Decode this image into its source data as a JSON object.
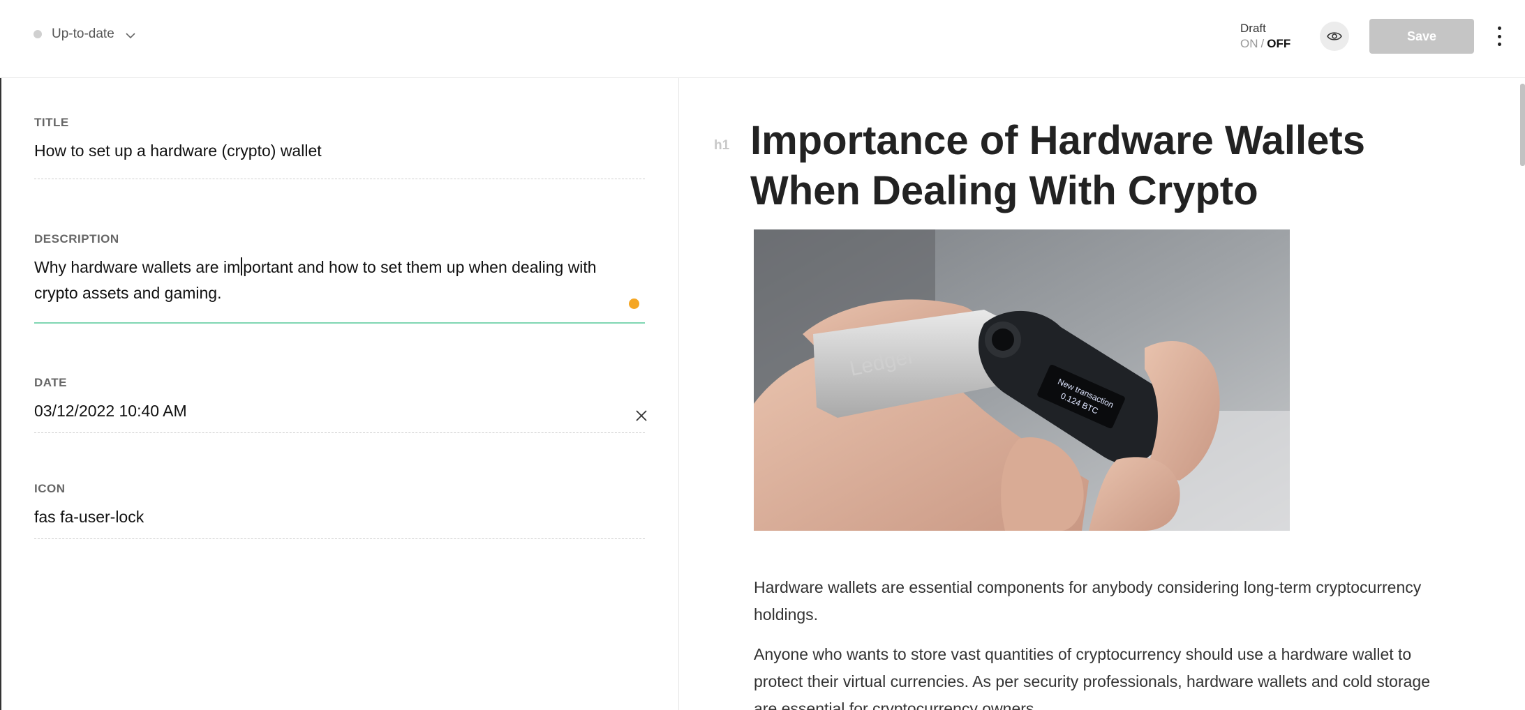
{
  "header": {
    "status_label": "Up-to-date",
    "draft_label": "Draft",
    "draft_on": "ON",
    "draft_sep": "/",
    "draft_off": "OFF",
    "save_label": "Save"
  },
  "form": {
    "title": {
      "label": "TITLE",
      "value": "How to set up a hardware (crypto) wallet"
    },
    "description": {
      "label": "DESCRIPTION",
      "value_before_caret": "Why hardware wallets are im",
      "value_after_caret": "portant and how to set them up when dealing with",
      "value_line2": "crypto assets and gaming."
    },
    "date": {
      "label": "DATE",
      "value": "03/12/2022 10:40 AM"
    },
    "icon": {
      "label": "ICON",
      "value": "fas fa-user-lock"
    }
  },
  "preview": {
    "heading_hint": "h1",
    "title": "Importance of Hardware Wallets When Dealing With Crypto",
    "image_caption": "Ledger",
    "device_screen_line1": "New transaction",
    "device_screen_line2": "0.124 BTC",
    "paragraphs": [
      "Hardware wallets are essential components for anybody considering long-term cryptocurrency holdings.",
      "Anyone who wants to store vast quantities of cryptocurrency should use a hardware wallet to protect their virtual currencies. As per security professionals, hardware wallets and cold storage are essential for cryptocurrency owners."
    ]
  },
  "colors": {
    "accent_green": "#7fd6b3",
    "unsaved_dot": "#f5a623",
    "save_disabled": "#c5c5c5"
  }
}
